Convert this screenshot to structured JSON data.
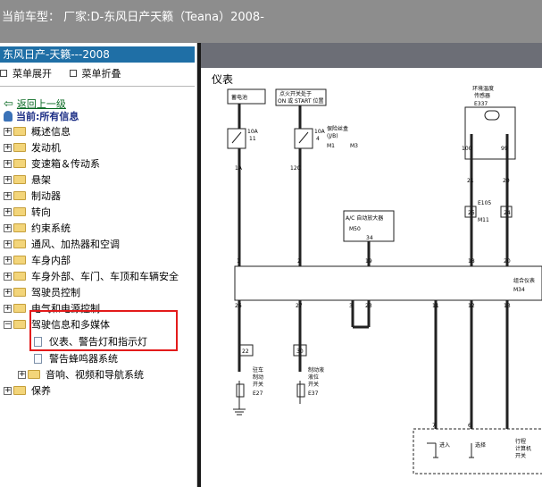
{
  "top_bar": {
    "title": "当前车型： 厂家:D-东风日产天籁（Teana）2008-"
  },
  "sidebar": {
    "brand": "东风日产-天籁---2008",
    "menu": [
      "菜单展开",
      "菜单折叠"
    ],
    "back": "返回上一级",
    "current": "当前:所有信息",
    "items": [
      {
        "label": "概述信息"
      },
      {
        "label": "发动机"
      },
      {
        "label": "变速箱＆传动系"
      },
      {
        "label": "悬架"
      },
      {
        "label": "制动器"
      },
      {
        "label": "转向"
      },
      {
        "label": "约束系统"
      },
      {
        "label": "通风、加热器和空调"
      },
      {
        "label": "车身内部"
      },
      {
        "label": "车身外部、车门、车顶和车辆安全"
      },
      {
        "label": "驾驶员控制"
      },
      {
        "label": "电气和电源控制"
      },
      {
        "label": "驾驶信息和多媒体"
      },
      {
        "label": "仪表、警告灯和指示灯"
      },
      {
        "label": "警告蜂鸣器系统"
      },
      {
        "label": "音响、视频和导航系统"
      },
      {
        "label": "保养"
      }
    ]
  },
  "diagram": {
    "title": "仪表",
    "labels": {
      "battery": "蓄电池",
      "ignition_line1": "点火开关处于",
      "ignition_line2": "ON 或 START 位置",
      "fuse_box_1": "保险丝盒",
      "fuse_box_2": "(J/B)",
      "fuse1_rating": "10A",
      "fuse1_no": "11",
      "fuse2_rating": "10A",
      "fuse2_no": "4",
      "m1": "M1",
      "m3": "M3",
      "amb_1": "环境温度",
      "amb_2": "传感器",
      "e337": "E337",
      "ac_amp": "A/C 自动放大器",
      "m50": "M50",
      "pin_34": "34",
      "e105": "E105",
      "m11": "M11",
      "combo_meter": "组合仪表",
      "m34": "M34",
      "park_1": "驻车",
      "park_2": "制动",
      "park_3": "开关",
      "e27": "E27",
      "brake_1": "制动液",
      "brake_2": "液位",
      "brake_3": "开关",
      "e37": "E37",
      "trip_1": "行程",
      "trip_2": "计算机",
      "trip_3": "开关",
      "enter": "进入",
      "select": "选择",
      "w_1a": "1A",
      "w_12c": "12C",
      "w_100": "100",
      "w_99": "99",
      "w_21": "21",
      "w_20": "20",
      "w_1": "1",
      "w_2": "2",
      "w_19": "19",
      "w_18": "18",
      "w_25": "25",
      "w_24": "24",
      "w_26": "26",
      "w_27": "27",
      "w_3": "3",
      "w_23": "23",
      "w_11": "11",
      "w_12": "12",
      "w_13": "13",
      "w_22": "22",
      "w_30": "30",
      "w_7": "7",
      "w_6": "6"
    }
  }
}
